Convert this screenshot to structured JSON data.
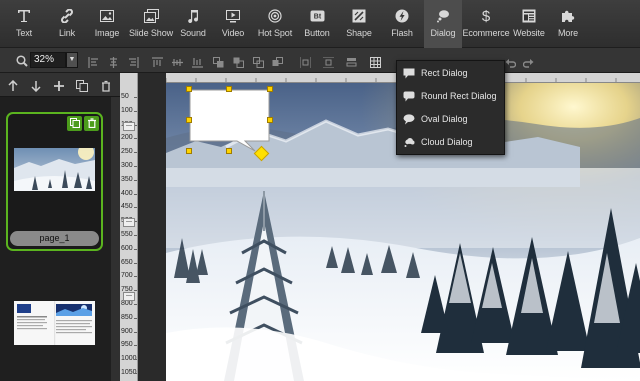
{
  "toolbar": {
    "items": [
      {
        "label": "Text",
        "icon": "text-icon"
      },
      {
        "label": "Link",
        "icon": "link-icon"
      },
      {
        "label": "Image",
        "icon": "image-icon"
      },
      {
        "label": "Slide Show",
        "icon": "slideshow-icon"
      },
      {
        "label": "Sound",
        "icon": "sound-icon"
      },
      {
        "label": "Video",
        "icon": "video-icon"
      },
      {
        "label": "Hot Spot",
        "icon": "hotspot-icon"
      },
      {
        "label": "Button",
        "icon": "button-icon"
      },
      {
        "label": "Shape",
        "icon": "shape-icon"
      },
      {
        "label": "Flash",
        "icon": "flash-icon"
      },
      {
        "label": "Dialog",
        "icon": "dialog-icon",
        "active": true
      },
      {
        "label": "Ecommerce",
        "icon": "ecommerce-icon"
      },
      {
        "label": "Website",
        "icon": "website-icon"
      },
      {
        "label": "More",
        "icon": "more-icon"
      }
    ]
  },
  "zoom": {
    "value": "32%"
  },
  "pages": {
    "page1_label": "page_1"
  },
  "ruler": {
    "vertical_ticks": [
      "50",
      "100",
      "150",
      "200",
      "250",
      "300",
      "350",
      "400",
      "450",
      "500",
      "550",
      "600",
      "650",
      "700",
      "750",
      "800",
      "850",
      "900",
      "950",
      "1000",
      "1050"
    ]
  },
  "dialog_menu": {
    "items": [
      {
        "label": "Rect Dialog",
        "icon": "rect-dialog-icon"
      },
      {
        "label": "Round Rect Dialog",
        "icon": "round-rect-dialog-icon"
      },
      {
        "label": "Oval Dialog",
        "icon": "oval-dialog-icon"
      },
      {
        "label": "Cloud Dialog",
        "icon": "cloud-dialog-icon"
      }
    ]
  },
  "colors": {
    "accent_green": "#5bb41f",
    "handle_yellow": "#ffd400",
    "toolbar_bg": "#353535"
  }
}
